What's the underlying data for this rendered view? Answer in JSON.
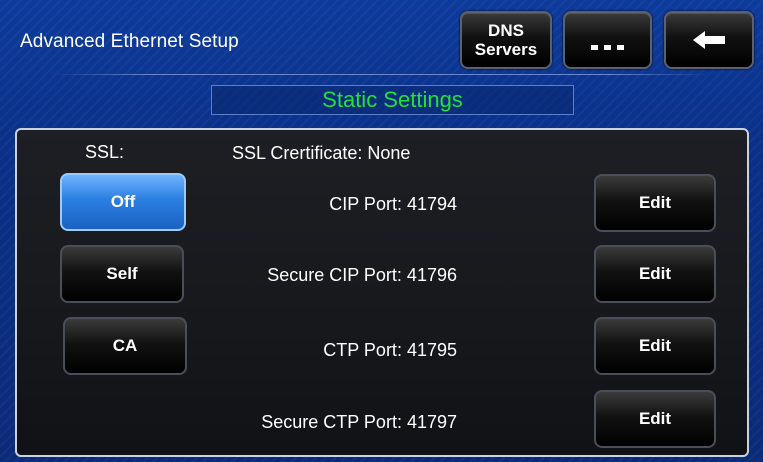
{
  "header": {
    "title": "Advanced Ethernet Setup",
    "dns_line1": "DNS",
    "dns_line2": "Servers",
    "more_icon": "ellipsis-icon",
    "back_icon": "back-arrow-icon"
  },
  "section": {
    "title": "Static Settings"
  },
  "ssl": {
    "label": "SSL:",
    "options": [
      "Off",
      "Self",
      "CA"
    ],
    "selected": "Off"
  },
  "certificate": {
    "label": "SSL Crertificate: None"
  },
  "ports": [
    {
      "label": "CIP Port: 41794",
      "edit": "Edit"
    },
    {
      "label": "Secure CIP Port: 41796",
      "edit": "Edit"
    },
    {
      "label": "CTP Port: 41795",
      "edit": "Edit"
    },
    {
      "label": "Secure CTP Port: 41797",
      "edit": "Edit"
    }
  ],
  "colors": {
    "background": "#0a2f86",
    "accent_green": "#22e03a",
    "selected_blue": "#2b7fe0"
  }
}
